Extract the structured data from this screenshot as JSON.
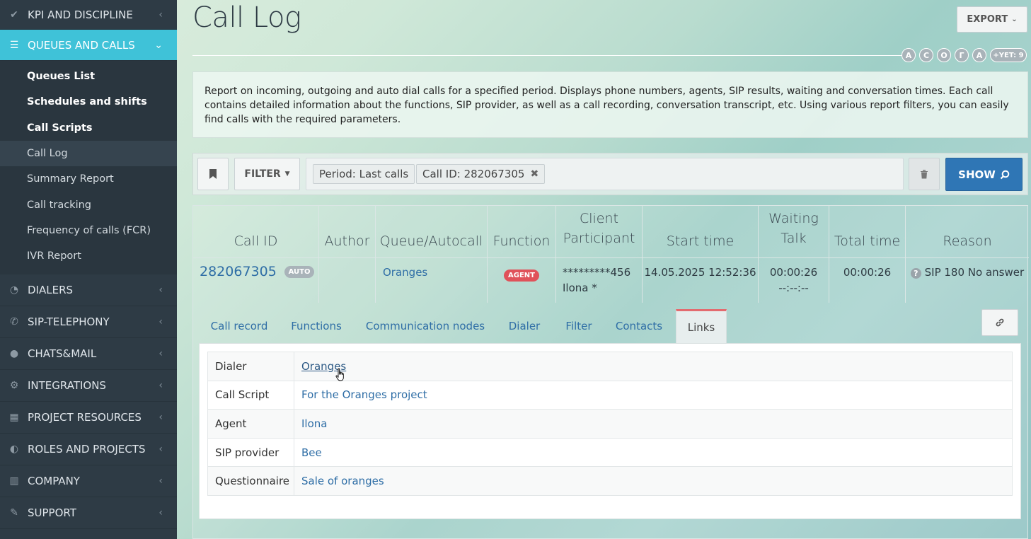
{
  "sidebar": {
    "items_top": [
      {
        "label": "KPI AND DISCIPLINE",
        "icon": "check-icon"
      },
      {
        "label": "QUEUES AND CALLS",
        "icon": "list-icon"
      }
    ],
    "submenu": [
      {
        "label": "Queues List"
      },
      {
        "label": "Schedules and shifts"
      },
      {
        "label": "Call Scripts"
      },
      {
        "label": "Call Log"
      },
      {
        "label": "Summary Report"
      },
      {
        "label": "Call tracking"
      },
      {
        "label": "Frequency of calls (FCR)"
      },
      {
        "label": "IVR Report"
      }
    ],
    "items_bottom": [
      {
        "label": "DIALERS",
        "icon": "dashboard-icon"
      },
      {
        "label": "SIP-TELEPHONY",
        "icon": "phone-icon"
      },
      {
        "label": "CHATS&MAIL",
        "icon": "chat-icon"
      },
      {
        "label": "INTEGRATIONS",
        "icon": "gears-icon"
      },
      {
        "label": "PROJECT RESOURCES",
        "icon": "grid-icon"
      },
      {
        "label": "ROLES AND PROJECTS",
        "icon": "toggle-icon"
      },
      {
        "label": "COMPANY",
        "icon": "bar-chart-icon"
      },
      {
        "label": "SUPPORT",
        "icon": "wrench-icon"
      }
    ]
  },
  "page": {
    "title": "Call Log",
    "export_label": "EXPORT",
    "letters": [
      "А",
      "С",
      "О",
      "Г",
      "А"
    ],
    "letters_more": "+YET: 9",
    "description": "Report on incoming, outgoing and auto dial calls for a specified period. Displays phone numbers, agents, SIP results, waiting and conversation times. Each call contains detailed information about the functions, SIP provider, as well as a call recording, conversation transcript, etc. Using various report filters, you can easily find calls with the required parameters."
  },
  "filter": {
    "filter_label": "FILTER",
    "chips": [
      "Period: Last calls",
      "Call ID: 282067305"
    ],
    "show_label": "SHOW"
  },
  "table": {
    "headers": {
      "call_id": "Call ID",
      "author": "Author",
      "queue": "Queue/Autocall",
      "function": "Function",
      "client_1": "Client",
      "client_2": "Participant",
      "start": "Start time",
      "waiting_1": "Waiting",
      "waiting_2": "Talk",
      "total": "Total time",
      "reason": "Reason"
    },
    "row": {
      "call_id": "282067305",
      "call_badge": "AUTO",
      "author": "",
      "queue": "Oranges",
      "function_badge": "AGENT",
      "client": "*********456",
      "participant": "Ilona *",
      "start": "14.05.2025 12:52:36",
      "waiting": "00:00:26",
      "talk": "--:--:--",
      "total": "00:00:26",
      "reason": "SIP 180 No answer"
    }
  },
  "tabs": [
    "Call record",
    "Functions",
    "Communication nodes",
    "Dialer",
    "Filter",
    "Contacts",
    "Links"
  ],
  "links": [
    {
      "key": "Dialer",
      "value": "Oranges"
    },
    {
      "key": "Call Script",
      "value": "For the Oranges project"
    },
    {
      "key": "Agent",
      "value": "Ilona"
    },
    {
      "key": "SIP provider",
      "value": "Bee"
    },
    {
      "key": "Questionnaire",
      "value": "Sale of oranges"
    }
  ]
}
